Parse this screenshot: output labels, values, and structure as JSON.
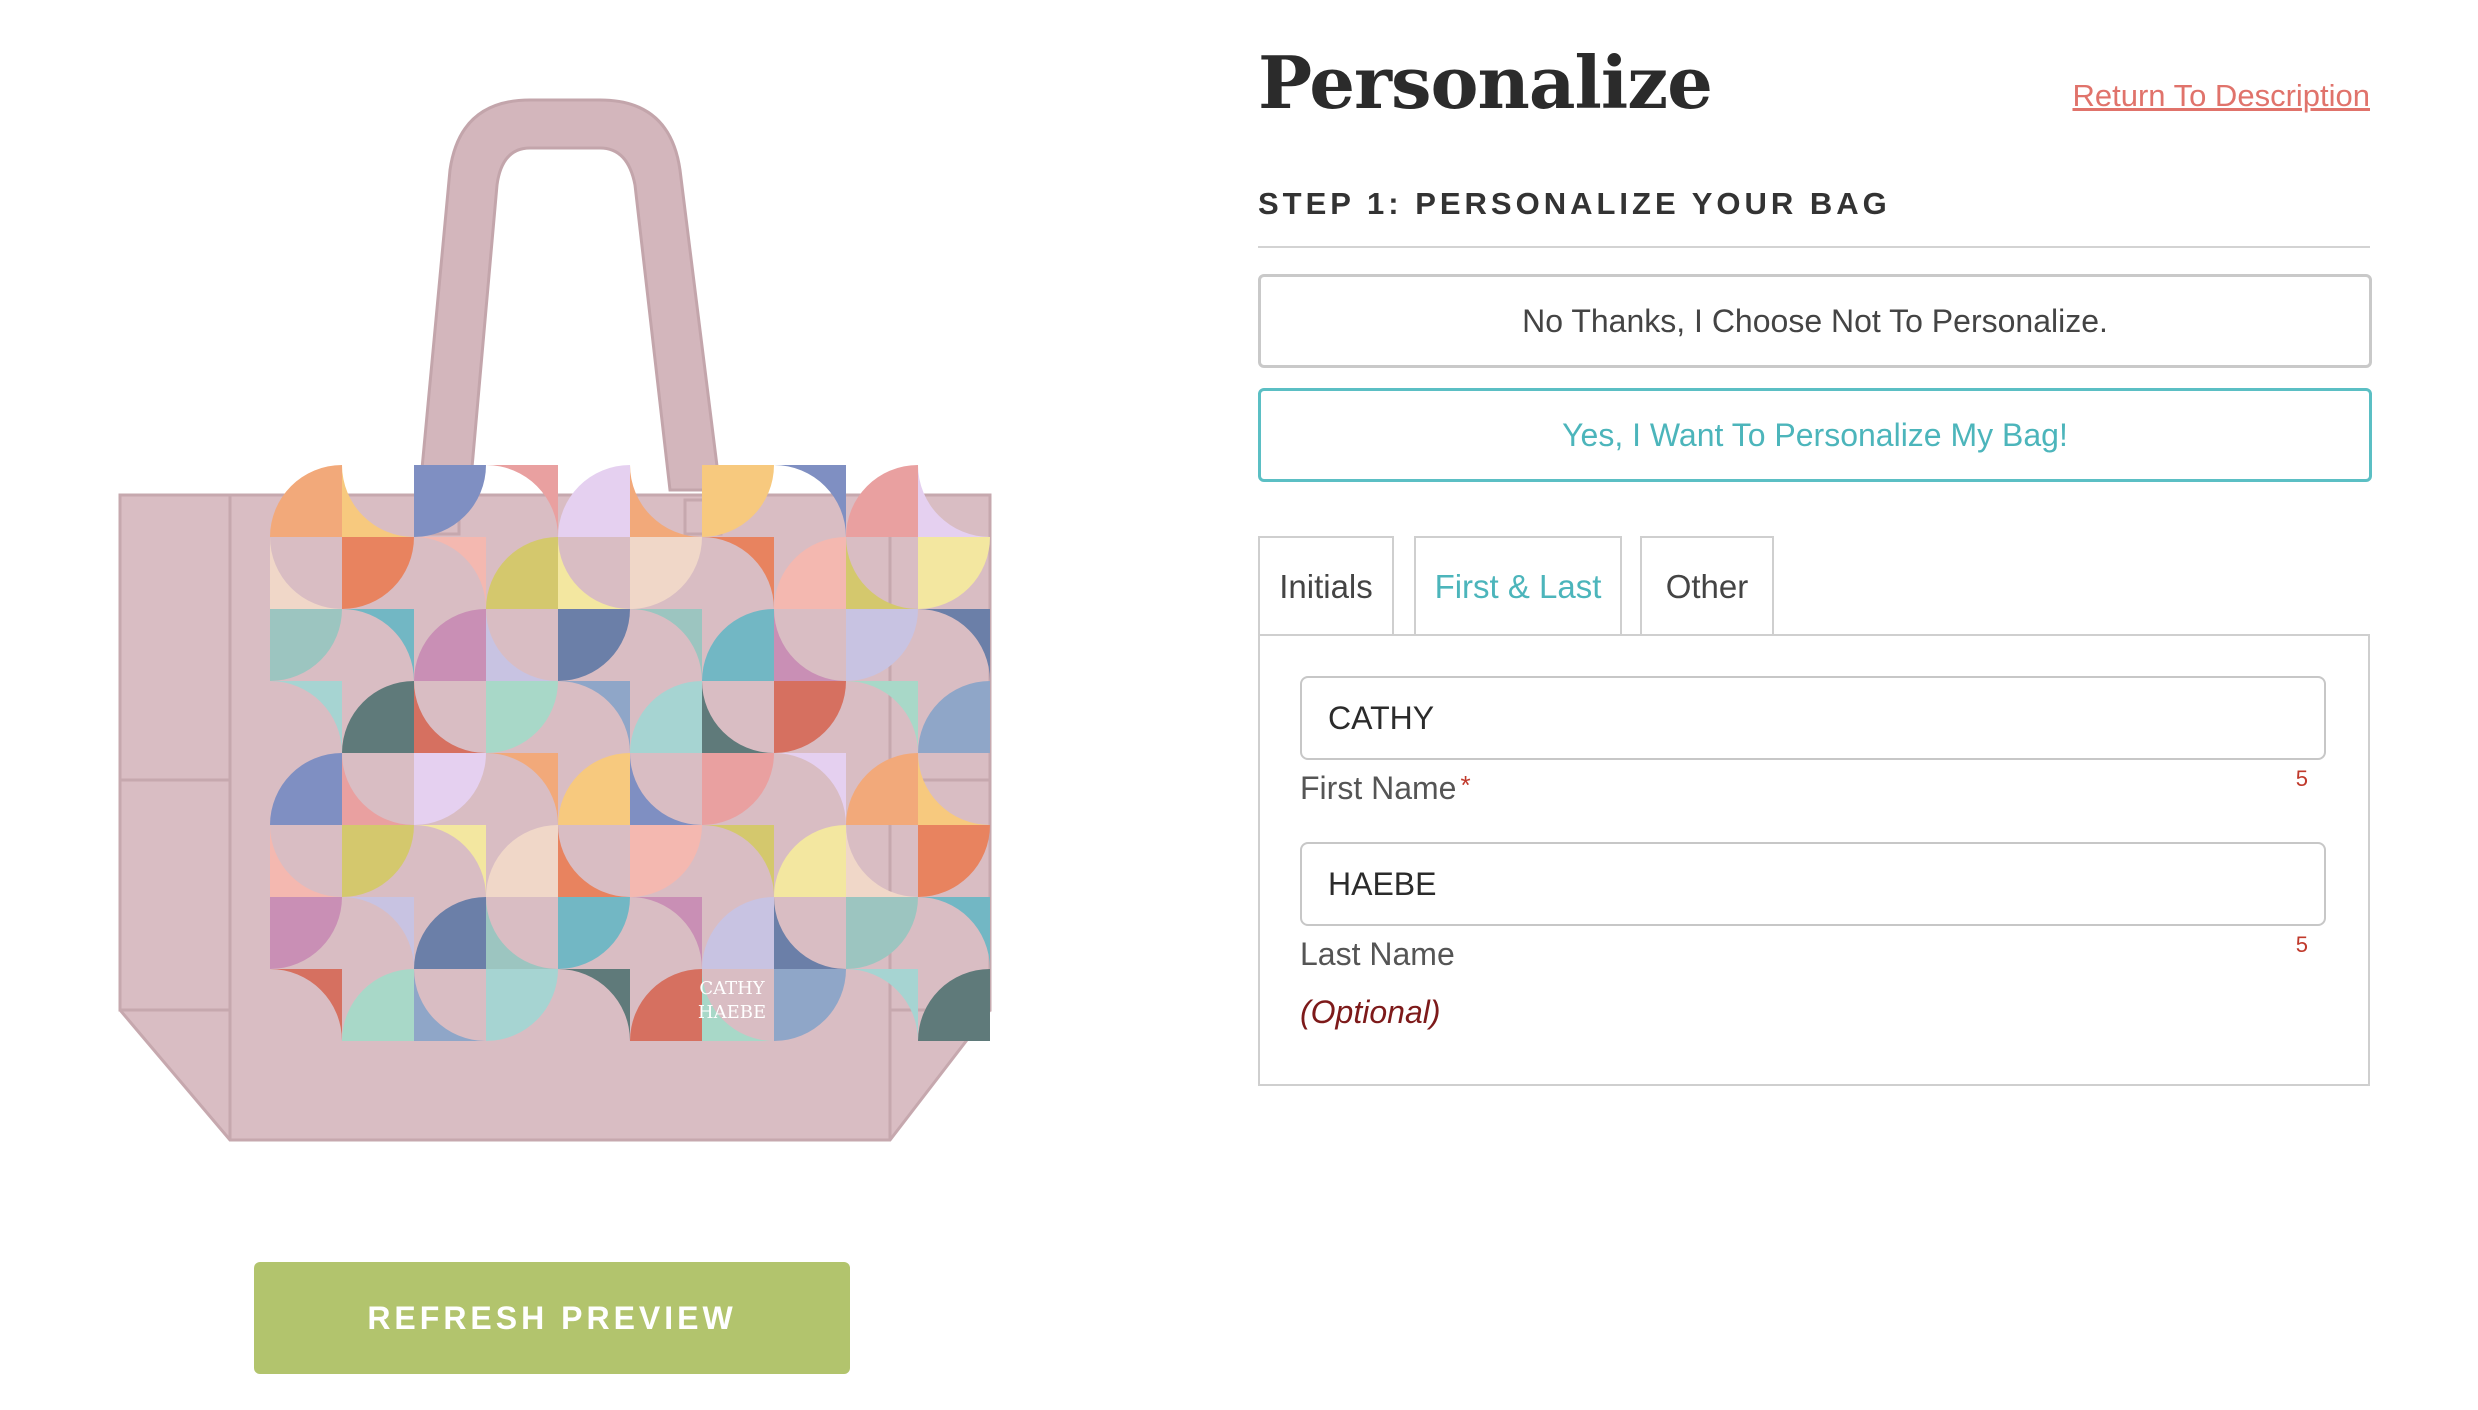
{
  "preview": {
    "bag_text_line1": "CATHY",
    "bag_text_line2": "HAEBE",
    "refresh_label": "REFRESH PREVIEW",
    "colors": {
      "bag": "#d9bdc3",
      "button": "#b2c46d"
    }
  },
  "personalize": {
    "title": "Personalize",
    "return_link": "Return To Description",
    "step_heading": "STEP 1: PERSONALIZE YOUR BAG",
    "options": {
      "no": "No Thanks, I Choose Not To Personalize.",
      "yes": "Yes, I Want To Personalize My Bag!"
    },
    "tabs": [
      {
        "label": "Initials"
      },
      {
        "label": "First & Last"
      },
      {
        "label": "Other"
      }
    ],
    "first_name": {
      "value": "CATHY",
      "label": "First Name",
      "required_mark": "*",
      "remaining": "5"
    },
    "last_name": {
      "value": "HAEBE",
      "label": "Last Name",
      "remaining": "5",
      "optional_label": "(Optional)"
    },
    "colors": {
      "accent": "#4cb5bb",
      "link": "#e0736b",
      "required": "#c0392b"
    }
  }
}
